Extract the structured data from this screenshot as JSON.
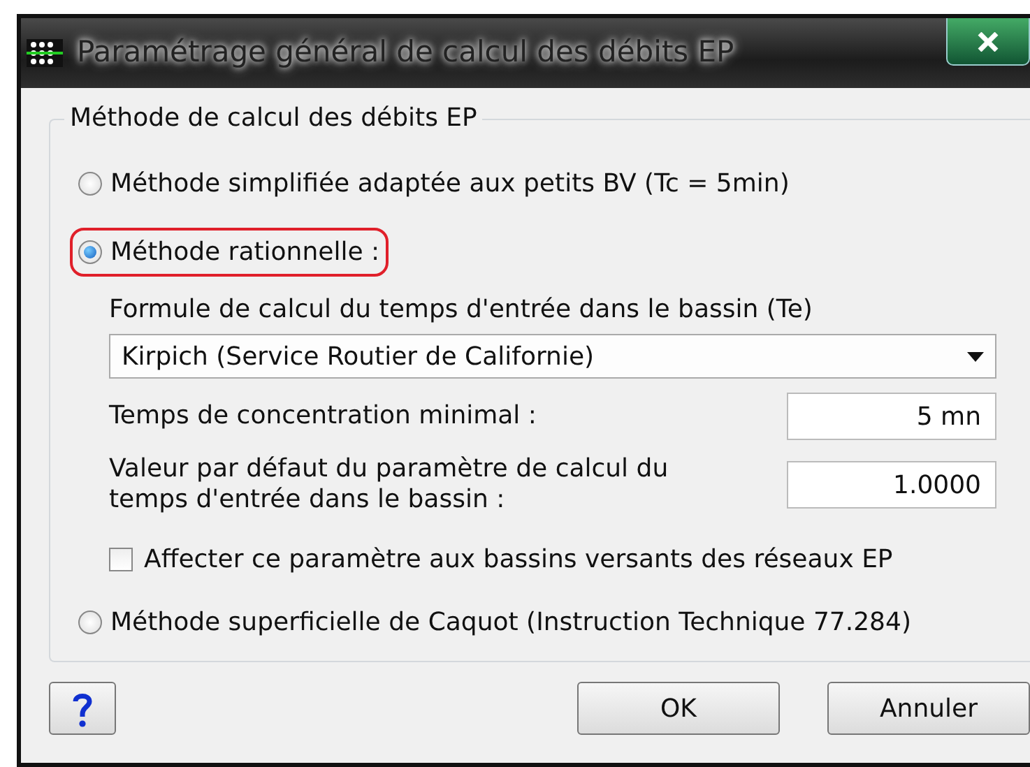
{
  "window": {
    "title": "Paramétrage général de calcul des débits EP"
  },
  "group": {
    "title": "Méthode de calcul des débits EP"
  },
  "methods": [
    {
      "label": "Méthode simplifiée adaptée aux petits BV (Tc = 5min)",
      "selected": false,
      "highlighted": false
    },
    {
      "label": "Méthode rationnelle :",
      "selected": true,
      "highlighted": true
    },
    {
      "label": "Méthode superficielle de Caquot (Instruction Technique 77.284)",
      "selected": false,
      "highlighted": false
    }
  ],
  "rational": {
    "formula_label": "Formule de calcul du temps d'entrée dans le bassin (Te)",
    "formula_value": "Kirpich (Service Routier de Californie)",
    "fields": [
      {
        "label": "Temps de concentration minimal :",
        "value": "5 mn"
      },
      {
        "label": "Valeur par défaut du paramètre de calcul du temps d'entrée dans le bassin :",
        "value": "1.0000"
      }
    ],
    "checkbox": {
      "label": "Affecter ce paramètre aux bassins versants des réseaux EP",
      "checked": false
    }
  },
  "buttons": [
    {
      "kind": "help"
    },
    {
      "kind": "text",
      "label": "OK"
    },
    {
      "kind": "text",
      "label": "Annuler"
    }
  ]
}
